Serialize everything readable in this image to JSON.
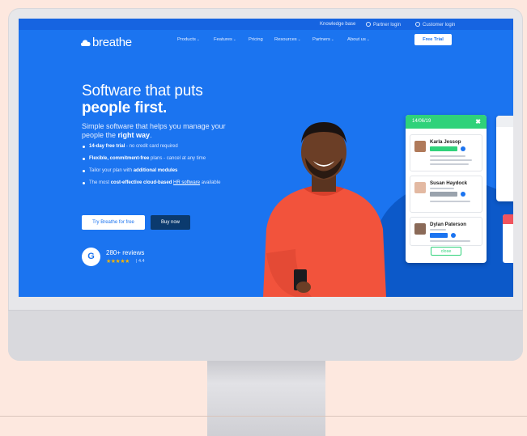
{
  "topbar": {
    "knowledge_base": "Knowledge base",
    "partner_login": "Partner login",
    "customer_login": "Customer login"
  },
  "nav": {
    "logo": "breathe",
    "items": [
      "Products",
      "Features",
      "Pricing",
      "Resources",
      "Partners",
      "About us"
    ],
    "cta": "Free Trial"
  },
  "hero": {
    "title_line1": "Software that puts",
    "title_line2": "people first.",
    "subtitle_pre": "Simple software that helps you manage your people the ",
    "subtitle_bold": "right way",
    "subtitle_post": ".",
    "bullets": [
      {
        "bold": "14-day free trial",
        "text": " - no credit card required"
      },
      {
        "bold": "Flexible, commitment-free",
        "text": " plans - cancel at any time"
      },
      {
        "pre": "Tailor your plan with ",
        "bold": "additional modules"
      },
      {
        "pre": "The most ",
        "bold": "cost-effective cloud-based",
        "link": "HR software",
        "post": " available"
      }
    ],
    "btn_trial": "Try Breathe for free",
    "btn_buy": "Buy now",
    "reviews_badge": "G",
    "reviews_count": "280+ reviews",
    "stars": "★★★★★",
    "rating": "| 4.4"
  },
  "absence_card": {
    "date": "14/06/19",
    "close_icon": "✖",
    "entries": [
      {
        "name": "Karla Jessop",
        "tag": "",
        "tag_color": "#2fd27a"
      },
      {
        "name": "Susan Haydock",
        "tag": "",
        "tag_color": "#9aa3ad"
      },
      {
        "name": "Dylan Paterson",
        "tag": "",
        "tag_color": "#1b74f0"
      }
    ],
    "button": "close"
  },
  "colors": {
    "brand_blue": "#1b74f0",
    "accent_green": "#2fd27a",
    "dark_navy": "#0b3a6e",
    "peach_bg": "#fde8df"
  }
}
